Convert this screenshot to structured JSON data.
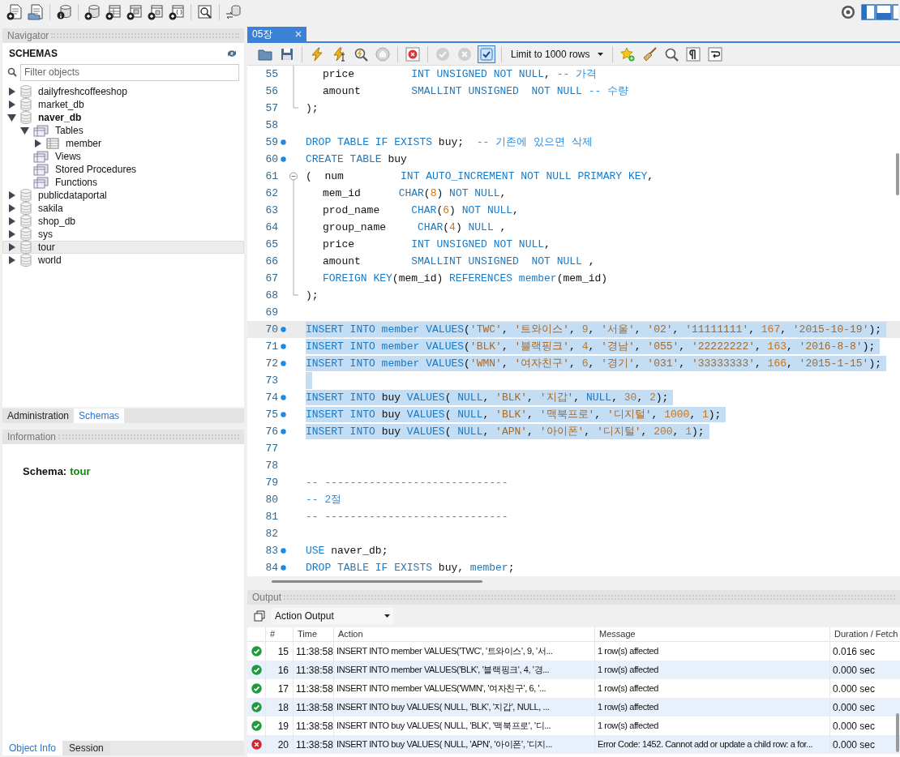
{
  "navigator": {
    "title": "Navigator",
    "section": "SCHEMAS",
    "filter": {
      "placeholder": "Filter objects"
    },
    "schemas": [
      {
        "label": "dailyfreshcoffeeshop",
        "kind": "schema",
        "expanded": false,
        "selected": false,
        "default": false
      },
      {
        "label": "market_db",
        "kind": "schema",
        "expanded": false,
        "selected": false,
        "default": false
      },
      {
        "label": "naver_db",
        "kind": "schema",
        "expanded": true,
        "selected": false,
        "default": true,
        "children": [
          {
            "label": "Tables",
            "kind": "folder",
            "expanded": true,
            "selected": false,
            "children": [
              {
                "label": "member",
                "kind": "table",
                "expanded": false,
                "selected": false
              }
            ]
          },
          {
            "label": "Views",
            "kind": "folder",
            "selected": false
          },
          {
            "label": "Stored Procedures",
            "kind": "folder",
            "selected": false
          },
          {
            "label": "Functions",
            "kind": "folder",
            "selected": false
          }
        ]
      },
      {
        "label": "publicdataportal",
        "kind": "schema",
        "expanded": false,
        "selected": false,
        "default": false
      },
      {
        "label": "sakila",
        "kind": "schema",
        "expanded": false,
        "selected": false,
        "default": false
      },
      {
        "label": "shop_db",
        "kind": "schema",
        "expanded": false,
        "selected": false,
        "default": false
      },
      {
        "label": "sys",
        "kind": "schema",
        "expanded": false,
        "selected": false,
        "default": false
      },
      {
        "label": "tour",
        "kind": "schema",
        "expanded": false,
        "selected": true,
        "default": false
      },
      {
        "label": "world",
        "kind": "schema",
        "expanded": false,
        "selected": false,
        "default": false
      }
    ]
  },
  "side_tabs": [
    {
      "label": "Administration",
      "selected": false
    },
    {
      "label": "Schemas",
      "selected": true
    }
  ],
  "information": {
    "title": "Information",
    "label": "Schema:",
    "value": "tour"
  },
  "bottom_tabs": [
    {
      "label": "Object Info",
      "selected": true
    },
    {
      "label": "Session",
      "selected": false
    }
  ],
  "editor": {
    "tabs": [
      {
        "label": "05장",
        "selected": true
      }
    ],
    "toolbar": {
      "limit": "Limit to 1000 rows",
      "buttons": [
        {
          "kind": "open",
          "disabled": false,
          "on": false
        },
        {
          "kind": "save",
          "disabled": false,
          "on": false
        },
        {
          "kind": "execute",
          "disabled": false,
          "on": false
        },
        {
          "kind": "execute_current",
          "disabled": false,
          "on": false
        },
        {
          "kind": "explain",
          "disabled": false,
          "on": false
        },
        {
          "kind": "stop",
          "disabled": false,
          "on": false
        },
        {
          "kind": "stop_on_error",
          "disabled": false,
          "on": false
        },
        {
          "kind": "commit",
          "disabled": true,
          "on": false
        },
        {
          "kind": "rollback",
          "disabled": true,
          "on": false
        },
        {
          "kind": "autocommit",
          "disabled": false,
          "on": true
        },
        {
          "kind": "snippet",
          "disabled": false,
          "on": false
        },
        {
          "kind": "beautify",
          "disabled": false,
          "on": false
        },
        {
          "kind": "find",
          "disabled": false,
          "on": false
        },
        {
          "kind": "invisibles",
          "disabled": false,
          "on": false
        },
        {
          "kind": "wrap",
          "disabled": false,
          "on": false
        }
      ]
    },
    "lines": [
      {
        "number": "55",
        "marker": false,
        "fold": {
          "kind": "mid"
        },
        "indented": true,
        "selected": false,
        "current": false,
        "tokens": [
          {
            "kind": "plain",
            "text": "price         "
          },
          {
            "kind": "keyword",
            "text": "INT UNSIGNED NOT NULL"
          },
          {
            "kind": "plain",
            "text": ", "
          },
          {
            "kind": "comment",
            "text": "-- 가격"
          }
        ]
      },
      {
        "number": "56",
        "marker": false,
        "fold": {
          "kind": "mid"
        },
        "indented": true,
        "selected": false,
        "current": false,
        "tokens": [
          {
            "kind": "plain",
            "text": "amount        "
          },
          {
            "kind": "keyword",
            "text": "SMALLINT UNSIGNED  NOT NULL "
          },
          {
            "kind": "comment",
            "text": "-- 수량"
          }
        ]
      },
      {
        "number": "57",
        "marker": false,
        "fold": {
          "kind": "end"
        },
        "selected": false,
        "current": false,
        "tokens": [
          {
            "kind": "plain",
            "text": ");"
          }
        ]
      },
      {
        "number": "58",
        "marker": false,
        "selected": false,
        "current": false
      },
      {
        "number": "59",
        "marker": true,
        "selected": false,
        "current": false,
        "tokens": [
          {
            "kind": "keyword",
            "text": "DROP TABLE IF EXISTS "
          },
          {
            "kind": "plain",
            "text": "buy;  "
          },
          {
            "kind": "comment",
            "text": "-- 기존에 있으면 삭제"
          }
        ]
      },
      {
        "number": "60",
        "marker": true,
        "selected": false,
        "current": false,
        "tokens": [
          {
            "kind": "keyword",
            "text": "CREATE TABLE "
          },
          {
            "kind": "plain",
            "text": "buy"
          }
        ]
      },
      {
        "number": "61",
        "marker": false,
        "fold": {
          "kind": "start"
        },
        "selected": false,
        "current": false,
        "tokens": [
          {
            "kind": "plain",
            "text": "(  num         "
          },
          {
            "kind": "keyword",
            "text": "INT AUTO_INCREMENT NOT NULL PRIMARY KEY"
          },
          {
            "kind": "plain",
            "text": ","
          }
        ]
      },
      {
        "number": "62",
        "marker": false,
        "fold": {
          "kind": "mid"
        },
        "indented": true,
        "selected": false,
        "current": false,
        "tokens": [
          {
            "kind": "plain",
            "text": "mem_id      "
          },
          {
            "kind": "keyword",
            "text": "CHAR"
          },
          {
            "kind": "plain",
            "text": "("
          },
          {
            "kind": "number",
            "text": "8"
          },
          {
            "kind": "plain",
            "text": ") "
          },
          {
            "kind": "keyword",
            "text": "NOT NULL"
          },
          {
            "kind": "plain",
            "text": ","
          }
        ]
      },
      {
        "number": "63",
        "marker": false,
        "fold": {
          "kind": "mid"
        },
        "indented": true,
        "selected": false,
        "current": false,
        "tokens": [
          {
            "kind": "plain",
            "text": "prod_name     "
          },
          {
            "kind": "keyword",
            "text": "CHAR"
          },
          {
            "kind": "plain",
            "text": "("
          },
          {
            "kind": "number",
            "text": "6"
          },
          {
            "kind": "plain",
            "text": ") "
          },
          {
            "kind": "keyword",
            "text": "NOT NULL"
          },
          {
            "kind": "plain",
            "text": ","
          }
        ]
      },
      {
        "number": "64",
        "marker": false,
        "fold": {
          "kind": "mid"
        },
        "indented": true,
        "selected": false,
        "current": false,
        "tokens": [
          {
            "kind": "plain",
            "text": "group_name     "
          },
          {
            "kind": "keyword",
            "text": "CHAR"
          },
          {
            "kind": "plain",
            "text": "("
          },
          {
            "kind": "number",
            "text": "4"
          },
          {
            "kind": "plain",
            "text": ") "
          },
          {
            "kind": "keyword",
            "text": "NULL"
          },
          {
            "kind": "plain",
            "text": " ,"
          }
        ]
      },
      {
        "number": "65",
        "marker": false,
        "fold": {
          "kind": "mid"
        },
        "indented": true,
        "selected": false,
        "current": false,
        "tokens": [
          {
            "kind": "plain",
            "text": "price         "
          },
          {
            "kind": "keyword",
            "text": "INT UNSIGNED NOT NULL"
          },
          {
            "kind": "plain",
            "text": ","
          }
        ]
      },
      {
        "number": "66",
        "marker": false,
        "fold": {
          "kind": "mid"
        },
        "indented": true,
        "selected": false,
        "current": false,
        "tokens": [
          {
            "kind": "plain",
            "text": "amount        "
          },
          {
            "kind": "keyword",
            "text": "SMALLINT UNSIGNED  NOT NULL"
          },
          {
            "kind": "plain",
            "text": " ,"
          }
        ]
      },
      {
        "number": "67",
        "marker": false,
        "fold": {
          "kind": "mid"
        },
        "indented": true,
        "selected": false,
        "current": false,
        "tokens": [
          {
            "kind": "keyword",
            "text": "FOREIGN KEY"
          },
          {
            "kind": "plain",
            "text": "(mem_id) "
          },
          {
            "kind": "keyword",
            "text": "REFERENCES member"
          },
          {
            "kind": "plain",
            "text": "(mem_id)"
          }
        ]
      },
      {
        "number": "68",
        "marker": false,
        "fold": {
          "kind": "end"
        },
        "selected": false,
        "current": false,
        "tokens": [
          {
            "kind": "plain",
            "text": ");"
          }
        ]
      },
      {
        "number": "69",
        "marker": false,
        "selected": false,
        "current": false
      },
      {
        "number": "70",
        "marker": true,
        "selected": true,
        "current": true,
        "tokens": [
          {
            "kind": "keyword",
            "text": "INSERT INTO member VALUES"
          },
          {
            "kind": "plain",
            "text": "("
          },
          {
            "kind": "string",
            "text": "'TWC'"
          },
          {
            "kind": "plain",
            "text": ", "
          },
          {
            "kind": "string",
            "text": "'트와이스'"
          },
          {
            "kind": "plain",
            "text": ", "
          },
          {
            "kind": "number",
            "text": "9"
          },
          {
            "kind": "plain",
            "text": ", "
          },
          {
            "kind": "string",
            "text": "'서울'"
          },
          {
            "kind": "plain",
            "text": ", "
          },
          {
            "kind": "string",
            "text": "'02'"
          },
          {
            "kind": "plain",
            "text": ", "
          },
          {
            "kind": "string",
            "text": "'11111111'"
          },
          {
            "kind": "plain",
            "text": ", "
          },
          {
            "kind": "number",
            "text": "167"
          },
          {
            "kind": "plain",
            "text": ", "
          },
          {
            "kind": "string",
            "text": "'2015-10-19'"
          },
          {
            "kind": "plain",
            "text": ");"
          }
        ]
      },
      {
        "number": "71",
        "marker": true,
        "selected": true,
        "current": false,
        "tokens": [
          {
            "kind": "keyword",
            "text": "INSERT INTO member VALUES"
          },
          {
            "kind": "plain",
            "text": "("
          },
          {
            "kind": "string",
            "text": "'BLK'"
          },
          {
            "kind": "plain",
            "text": ", "
          },
          {
            "kind": "string",
            "text": "'블랙핑크'"
          },
          {
            "kind": "plain",
            "text": ", "
          },
          {
            "kind": "number",
            "text": "4"
          },
          {
            "kind": "plain",
            "text": ", "
          },
          {
            "kind": "string",
            "text": "'경남'"
          },
          {
            "kind": "plain",
            "text": ", "
          },
          {
            "kind": "string",
            "text": "'055'"
          },
          {
            "kind": "plain",
            "text": ", "
          },
          {
            "kind": "string",
            "text": "'22222222'"
          },
          {
            "kind": "plain",
            "text": ", "
          },
          {
            "kind": "number",
            "text": "163"
          },
          {
            "kind": "plain",
            "text": ", "
          },
          {
            "kind": "string",
            "text": "'2016-8-8'"
          },
          {
            "kind": "plain",
            "text": ");"
          }
        ]
      },
      {
        "number": "72",
        "marker": true,
        "selected": true,
        "current": false,
        "tokens": [
          {
            "kind": "keyword",
            "text": "INSERT INTO member VALUES"
          },
          {
            "kind": "plain",
            "text": "("
          },
          {
            "kind": "string",
            "text": "'WMN'"
          },
          {
            "kind": "plain",
            "text": ", "
          },
          {
            "kind": "string",
            "text": "'여자친구'"
          },
          {
            "kind": "plain",
            "text": ", "
          },
          {
            "kind": "number",
            "text": "6"
          },
          {
            "kind": "plain",
            "text": ", "
          },
          {
            "kind": "string",
            "text": "'경기'"
          },
          {
            "kind": "plain",
            "text": ", "
          },
          {
            "kind": "string",
            "text": "'031'"
          },
          {
            "kind": "plain",
            "text": ", "
          },
          {
            "kind": "string",
            "text": "'33333333'"
          },
          {
            "kind": "plain",
            "text": ", "
          },
          {
            "kind": "number",
            "text": "166"
          },
          {
            "kind": "plain",
            "text": ", "
          },
          {
            "kind": "string",
            "text": "'2015-1-15'"
          },
          {
            "kind": "plain",
            "text": ");"
          }
        ]
      },
      {
        "number": "73",
        "marker": false,
        "selected": true,
        "current": false
      },
      {
        "number": "74",
        "marker": true,
        "selected": true,
        "current": false,
        "tokens": [
          {
            "kind": "keyword",
            "text": "INSERT INTO "
          },
          {
            "kind": "plain",
            "text": "buy "
          },
          {
            "kind": "keyword",
            "text": "VALUES"
          },
          {
            "kind": "plain",
            "text": "( "
          },
          {
            "kind": "keyword",
            "text": "NULL"
          },
          {
            "kind": "plain",
            "text": ", "
          },
          {
            "kind": "string",
            "text": "'BLK'"
          },
          {
            "kind": "plain",
            "text": ", "
          },
          {
            "kind": "string",
            "text": "'지갑'"
          },
          {
            "kind": "plain",
            "text": ", "
          },
          {
            "kind": "keyword",
            "text": "NULL"
          },
          {
            "kind": "plain",
            "text": ", "
          },
          {
            "kind": "number",
            "text": "30"
          },
          {
            "kind": "plain",
            "text": ", "
          },
          {
            "kind": "number",
            "text": "2"
          },
          {
            "kind": "plain",
            "text": ");"
          }
        ]
      },
      {
        "number": "75",
        "marker": true,
        "selected": true,
        "current": false,
        "tokens": [
          {
            "kind": "keyword",
            "text": "INSERT INTO "
          },
          {
            "kind": "plain",
            "text": "buy "
          },
          {
            "kind": "keyword",
            "text": "VALUES"
          },
          {
            "kind": "plain",
            "text": "( "
          },
          {
            "kind": "keyword",
            "text": "NULL"
          },
          {
            "kind": "plain",
            "text": ", "
          },
          {
            "kind": "string",
            "text": "'BLK'"
          },
          {
            "kind": "plain",
            "text": ", "
          },
          {
            "kind": "string",
            "text": "'맥북프로'"
          },
          {
            "kind": "plain",
            "text": ", "
          },
          {
            "kind": "string",
            "text": "'디지털'"
          },
          {
            "kind": "plain",
            "text": ", "
          },
          {
            "kind": "number",
            "text": "1000"
          },
          {
            "kind": "plain",
            "text": ", "
          },
          {
            "kind": "number",
            "text": "1"
          },
          {
            "kind": "plain",
            "text": ");"
          }
        ]
      },
      {
        "number": "76",
        "marker": true,
        "selected": true,
        "current": false,
        "tokens": [
          {
            "kind": "keyword",
            "text": "INSERT INTO "
          },
          {
            "kind": "plain",
            "text": "buy "
          },
          {
            "kind": "keyword",
            "text": "VALUES"
          },
          {
            "kind": "plain",
            "text": "( "
          },
          {
            "kind": "keyword",
            "text": "NULL"
          },
          {
            "kind": "plain",
            "text": ", "
          },
          {
            "kind": "string",
            "text": "'APN'"
          },
          {
            "kind": "plain",
            "text": ", "
          },
          {
            "kind": "string",
            "text": "'아이폰'"
          },
          {
            "kind": "plain",
            "text": ", "
          },
          {
            "kind": "string",
            "text": "'디지털'"
          },
          {
            "kind": "plain",
            "text": ", "
          },
          {
            "kind": "number",
            "text": "200"
          },
          {
            "kind": "plain",
            "text": ", "
          },
          {
            "kind": "number",
            "text": "1"
          },
          {
            "kind": "plain",
            "text": ");"
          }
        ]
      },
      {
        "number": "77",
        "marker": false,
        "selected": false,
        "current": false
      },
      {
        "number": "78",
        "marker": false,
        "selected": false,
        "current": false
      },
      {
        "number": "79",
        "marker": false,
        "selected": false,
        "current": false,
        "tokens": [
          {
            "kind": "comment",
            "text": "-- -----------------------------"
          }
        ]
      },
      {
        "number": "80",
        "marker": false,
        "selected": false,
        "current": false,
        "tokens": [
          {
            "kind": "comment",
            "text": "-- 2절"
          }
        ]
      },
      {
        "number": "81",
        "marker": false,
        "selected": false,
        "current": false,
        "tokens": [
          {
            "kind": "comment",
            "text": "-- -----------------------------"
          }
        ]
      },
      {
        "number": "82",
        "marker": false,
        "selected": false,
        "current": false
      },
      {
        "number": "83",
        "marker": true,
        "selected": false,
        "current": false,
        "tokens": [
          {
            "kind": "keyword",
            "text": "USE "
          },
          {
            "kind": "plain",
            "text": "naver_db;"
          }
        ]
      },
      {
        "number": "84",
        "marker": true,
        "selected": false,
        "current": false,
        "tokens": [
          {
            "kind": "keyword",
            "text": "DROP TABLE IF EXISTS "
          },
          {
            "kind": "plain",
            "text": "buy, "
          },
          {
            "kind": "keyword",
            "text": "member"
          },
          {
            "kind": "plain",
            "text": ";"
          }
        ]
      }
    ]
  },
  "output": {
    "title": "Output",
    "mode": "Action Output",
    "columns": [
      "#",
      "Time",
      "Action",
      "Message",
      "Duration / Fetch"
    ],
    "rows": [
      {
        "error": false,
        "number": "15",
        "time": "11:38:58",
        "action": "INSERT INTO member VALUES('TWC', '트와이스', 9, '서...",
        "message": "1 row(s) affected",
        "duration": "0.016 sec"
      },
      {
        "error": false,
        "number": "16",
        "time": "11:38:58",
        "action": "INSERT INTO member VALUES('BLK', '블랙핑크', 4, '경...",
        "message": "1 row(s) affected",
        "duration": "0.000 sec"
      },
      {
        "error": false,
        "number": "17",
        "time": "11:38:58",
        "action": "INSERT INTO member VALUES('WMN', '여자친구', 6, '...",
        "message": "1 row(s) affected",
        "duration": "0.000 sec"
      },
      {
        "error": false,
        "number": "18",
        "time": "11:38:58",
        "action": "INSERT INTO buy VALUES( NULL, 'BLK', '지갑', NULL, ...",
        "message": "1 row(s) affected",
        "duration": "0.000 sec"
      },
      {
        "error": false,
        "number": "19",
        "time": "11:38:58",
        "action": "INSERT INTO buy VALUES( NULL, 'BLK', '맥북프로', '디...",
        "message": "1 row(s) affected",
        "duration": "0.000 sec"
      },
      {
        "error": true,
        "number": "20",
        "time": "11:38:58",
        "action": "INSERT INTO buy VALUES( NULL, 'APN', '아이폰', '디지...",
        "message": "Error Code: 1452. Cannot add or update a child row: a for...",
        "duration": "0.000 sec"
      }
    ]
  }
}
